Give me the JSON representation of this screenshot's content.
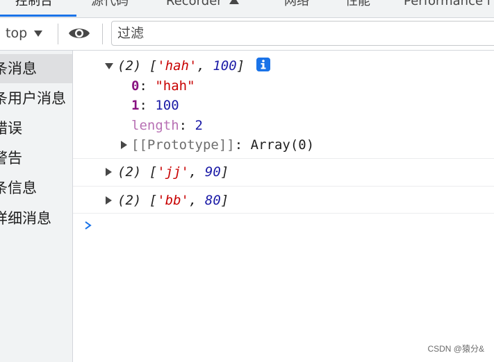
{
  "tabs": [
    {
      "label": "控制台"
    },
    {
      "label": "源代码"
    },
    {
      "label": "Recorder"
    },
    {
      "label": "网络"
    },
    {
      "label": "性能"
    },
    {
      "label": "Performance i"
    }
  ],
  "toolbar": {
    "context_label": "top",
    "filter_placeholder": "过滤"
  },
  "sidebar": {
    "items": [
      {
        "label": "条消息"
      },
      {
        "label": "条用户消息"
      },
      {
        "label": "错误"
      },
      {
        "label": "警告"
      },
      {
        "label": "条信息"
      },
      {
        "label": "详细消息"
      }
    ]
  },
  "console": {
    "entry1": {
      "count": "(2)",
      "open": "[",
      "str": "'hah'",
      "comma": ",",
      "num": "100",
      "close": "]",
      "idx0_key": "0",
      "idx0_val": "\"hah\"",
      "idx1_key": "1",
      "idx1_val": "100",
      "length_key": "length",
      "length_val": "2",
      "proto_key": "[[Prototype]]",
      "proto_val": "Array(0)",
      "colon": ":"
    },
    "entry2": {
      "count": "(2)",
      "open": "[",
      "str": "'jj'",
      "comma": ",",
      "num": "90",
      "close": "]"
    },
    "entry3": {
      "count": "(2)",
      "open": "[",
      "str": "'bb'",
      "comma": ",",
      "num": "80",
      "close": "]"
    }
  },
  "watermark": "CSDN @猿分&",
  "colors": {
    "accent": "#1a73e8",
    "string": "#c80000",
    "number": "#1a1aa6",
    "property": "#881280"
  }
}
